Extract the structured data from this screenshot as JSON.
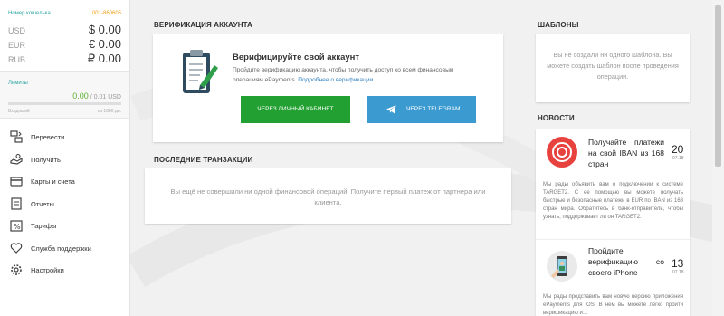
{
  "wallet": {
    "label": "Номер кошелька",
    "number": "001-860605",
    "currencies": [
      {
        "code": "USD",
        "amount": "$ 0.00"
      },
      {
        "code": "EUR",
        "amount": "€ 0.00"
      },
      {
        "code": "RUB",
        "amount": "₽ 0.00"
      }
    ]
  },
  "limits": {
    "label": "Лимиты",
    "current": "0.00",
    "max": "/ 0.01 USD",
    "incoming": "Входящий",
    "remaining": "из 1860 дн.",
    "progress_percent": 0
  },
  "nav": [
    {
      "label": "Перевести",
      "icon": "transfer-icon"
    },
    {
      "label": "Получить",
      "icon": "receive-icon"
    },
    {
      "label": "Карты и счета",
      "icon": "card-icon"
    },
    {
      "label": "Отчеты",
      "icon": "reports-icon"
    },
    {
      "label": "Тарифы",
      "icon": "tariffs-icon"
    },
    {
      "label": "Служба поддержки",
      "icon": "heart-icon"
    },
    {
      "label": "Настройки",
      "icon": "gear-icon"
    }
  ],
  "verification": {
    "section_title": "ВЕРИФИКАЦИЯ АККАУНТА",
    "title": "Верифицируйте свой аккаунт",
    "description": "Пройдите верификацию аккаунта, чтобы получить доступ ко всем финансовым операциям ePayments.",
    "link": "Подробнее о верификации.",
    "button_cabinet": "ЧЕРЕЗ ЛИЧНЫЙ КАБИНЕТ",
    "button_telegram": "ЧЕРЕЗ TELEGRAM"
  },
  "transactions": {
    "section_title": "ПОСЛЕДНИЕ ТРАНЗАКЦИИ",
    "empty_text": "Вы ещё не совершили ни одной финансовой операций. Получите первый платеж от партнера или клиента."
  },
  "templates": {
    "section_title": "ШАБЛОНЫ",
    "empty_text": "Вы не создали ни одного шаблона. Вы можете создать шаблон после проведения операции."
  },
  "news": {
    "section_title": "НОВОСТИ",
    "items": [
      {
        "title": "Получайте платежи на свой IBAN из 168 стран",
        "day": "20",
        "month": "07.18",
        "body": "Мы рады объявить вам о подключении к системе TARGET2. С ее помощью вы можете получать быстрые и безопасные платежи в EUR по IBAN из 168 стран мира. Обратитесь в банк-отправитель, чтобы узнать, поддерживает ли он TARGET2."
      },
      {
        "title": "Пройдите верификацию со своего iPhone",
        "day": "13",
        "month": "07.18",
        "body": "Мы рады представить вам новую версию приложения ePayments для iOS. В нем вы можете легко пройти верификацию и…"
      }
    ]
  },
  "colors": {
    "accent_teal": "#2aa5a0",
    "wallet_number": "#f39c12",
    "button_green": "#23a032",
    "button_blue": "#3b9ad0",
    "link_blue": "#2f7fbf"
  }
}
